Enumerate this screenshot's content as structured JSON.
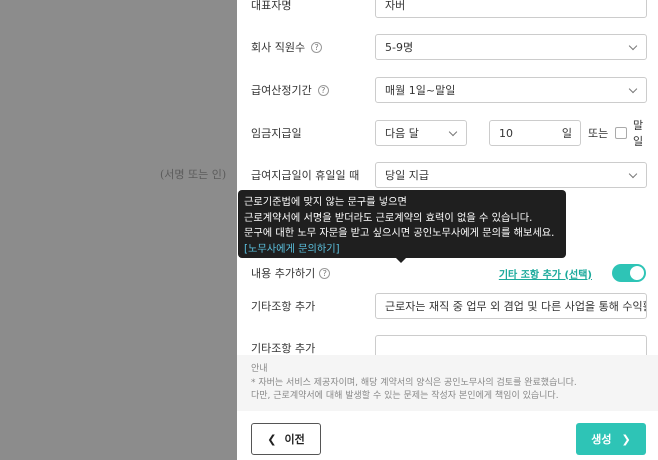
{
  "background": {
    "signature_placeholder": "(서명 또는 인)"
  },
  "form": {
    "representative": {
      "label": "대표자명",
      "value": "자버"
    },
    "employees": {
      "label": "회사 직원수",
      "value": "5-9명"
    },
    "pay_period": {
      "label": "급여산정기간",
      "value": "매월 1일~말일"
    },
    "pay_day": {
      "label": "임금지급일",
      "month_value": "다음 달",
      "day_value": "10",
      "day_unit": "일",
      "or_text": "또는",
      "last_day_label": "말일"
    },
    "holiday_pay": {
      "label": "급여지급일이 휴일일 때",
      "value": "당일 지급"
    },
    "add_content": {
      "label": "내용 추가하기",
      "toggle_label": "기타 조항 추가 (선택)",
      "toggle_on": true
    },
    "extra_clause_1": {
      "label": "기타조항 추가",
      "value": "근로자는 재직 중 업무 외 겸업 및 다른 사업을 통해 수익활동"
    },
    "extra_clause_2": {
      "label": "기타조항 추가",
      "value": ""
    }
  },
  "tooltip": {
    "line1": "근로기준법에 맞지 않는 문구를 넣으면",
    "line2": "근로계약서에 서명을 받더라도 근로계약의 효력이 없을 수 있습니다.",
    "line3": "문구에 대한 노무 자문을 받고 싶으시면 공인노무사에게 문의를 해보세요.",
    "link": "[노무사에게 문의하기]"
  },
  "notice": {
    "title": "안내",
    "line1": "* 자버는 서비스 제공자이며, 해당 계약서의 양식은 공인노무사의 검토를 완료했습니다.",
    "line2": "다만, 근로계약서에 대해 발생할 수 있는 문제는 작성자 본인에게 책임이 있습니다."
  },
  "footer": {
    "prev_label": "이전",
    "next_label": "생성"
  },
  "colors": {
    "accent": "#2ec4b6",
    "link": "#1aa99b",
    "tooltip_bg": "#1f1f1f"
  }
}
